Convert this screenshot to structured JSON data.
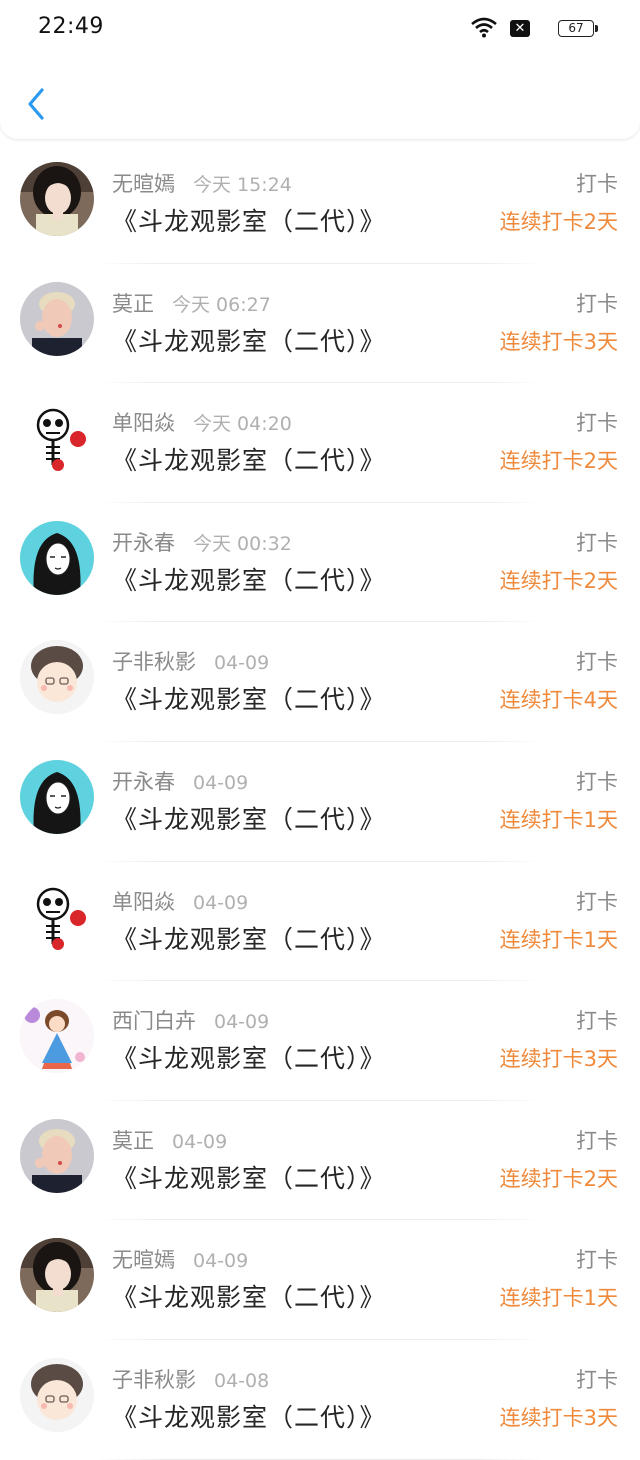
{
  "status_bar": {
    "time": "22:49",
    "battery": "67"
  },
  "entries": [
    {
      "name": "无暄嫣",
      "time": "今天 15:24",
      "title": "《斗龙观影室（二代）》",
      "action": "打卡",
      "streak": "连续打卡2天",
      "avatar": "girl-photo"
    },
    {
      "name": "莫正",
      "time": "今天 06:27",
      "title": "《斗龙观影室（二代）》",
      "action": "打卡",
      "streak": "连续打卡3天",
      "avatar": "blond-man"
    },
    {
      "name": "单阳焱",
      "time": "今天 04:20",
      "title": "《斗龙观影室（二代）》",
      "action": "打卡",
      "streak": "连续打卡2天",
      "avatar": "skeleton-boxer"
    },
    {
      "name": "开永春",
      "time": "今天 00:32",
      "title": "《斗龙观影室（二代）》",
      "action": "打卡",
      "streak": "连续打卡2天",
      "avatar": "anime-girl-cyan"
    },
    {
      "name": "子非秋影",
      "time": "04-09",
      "title": "《斗龙观影室（二代）》",
      "action": "打卡",
      "streak": "连续打卡4天",
      "avatar": "cartoon-boy"
    },
    {
      "name": "开永春",
      "time": "04-09",
      "title": "《斗龙观影室（二代）》",
      "action": "打卡",
      "streak": "连续打卡1天",
      "avatar": "anime-girl-cyan"
    },
    {
      "name": "单阳焱",
      "time": "04-09",
      "title": "《斗龙观影室（二代）》",
      "action": "打卡",
      "streak": "连续打卡1天",
      "avatar": "skeleton-boxer"
    },
    {
      "name": "西门白卉",
      "time": "04-09",
      "title": "《斗龙观影室（二代）》",
      "action": "打卡",
      "streak": "连续打卡3天",
      "avatar": "cartoon-girl"
    },
    {
      "name": "莫正",
      "time": "04-09",
      "title": "《斗龙观影室（二代）》",
      "action": "打卡",
      "streak": "连续打卡2天",
      "avatar": "blond-man"
    },
    {
      "name": "无暄嫣",
      "time": "04-09",
      "title": "《斗龙观影室（二代）》",
      "action": "打卡",
      "streak": "连续打卡1天",
      "avatar": "girl-photo"
    },
    {
      "name": "子非秋影",
      "time": "04-08",
      "title": "《斗龙观影室（二代）》",
      "action": "打卡",
      "streak": "连续打卡3天",
      "avatar": "cartoon-boy"
    }
  ],
  "colors": {
    "accent_orange": "#ef8a3d",
    "back_blue": "#2b9af3",
    "meta_gray": "#8a8a8a"
  }
}
